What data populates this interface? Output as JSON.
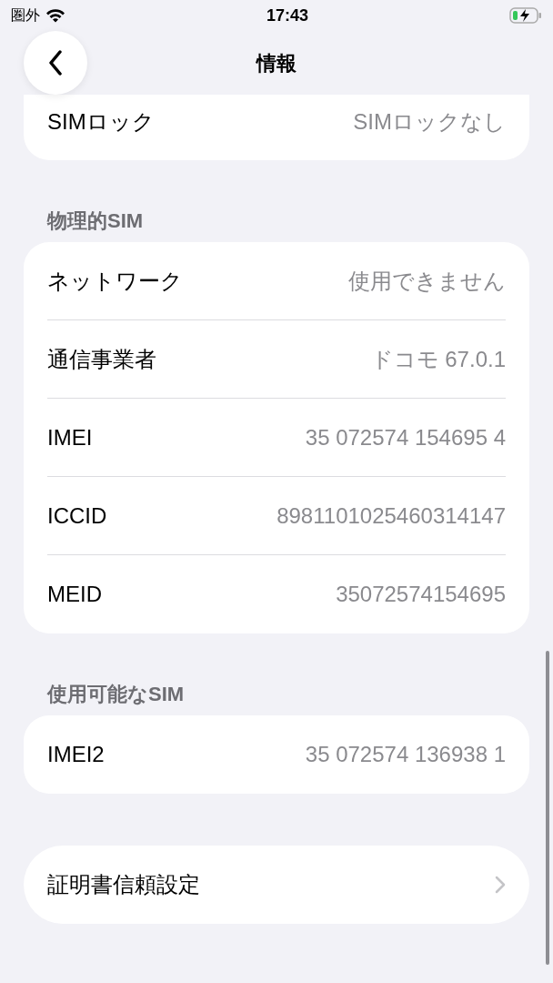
{
  "status_bar": {
    "carrier": "圏外",
    "time": "17:43"
  },
  "nav": {
    "title": "情報"
  },
  "top_card": {
    "rows": [
      {
        "label": "SIMロック",
        "value": "SIMロックなし"
      }
    ]
  },
  "sections": [
    {
      "header": "物理的SIM",
      "rows": [
        {
          "label": "ネットワーク",
          "value": "使用できません"
        },
        {
          "label": "通信事業者",
          "value": "ドコモ 67.0.1"
        },
        {
          "label": "IMEI",
          "value": "35 072574 154695 4"
        },
        {
          "label": "ICCID",
          "value": "8981101025460314147"
        },
        {
          "label": "MEID",
          "value": "35072574154695"
        }
      ]
    },
    {
      "header": "使用可能なSIM",
      "rows": [
        {
          "label": "IMEI2",
          "value": "35 072574 136938 1"
        }
      ]
    }
  ],
  "link_card": {
    "label": "証明書信頼設定"
  }
}
